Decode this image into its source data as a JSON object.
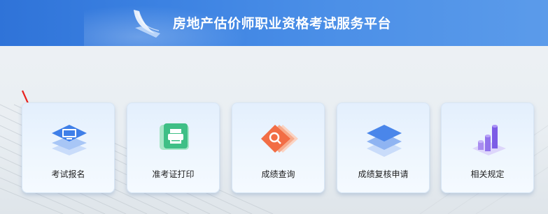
{
  "header": {
    "title": "房地产估价师职业资格考试服务平台",
    "logo_icon": "feather-book-logo-icon"
  },
  "cards": [
    {
      "label": "考试报名",
      "icon": "computer-layers-icon"
    },
    {
      "label": "准考证打印",
      "icon": "printer-icon"
    },
    {
      "label": "成绩查询",
      "icon": "search-cards-icon"
    },
    {
      "label": "成绩复核申请",
      "icon": "layers-icon"
    },
    {
      "label": "相关规定",
      "icon": "cylinder-chart-icon"
    }
  ],
  "colors": {
    "header_start": "#2f73d8",
    "header_end": "#5b9bea",
    "arrow": "#e8231f"
  }
}
